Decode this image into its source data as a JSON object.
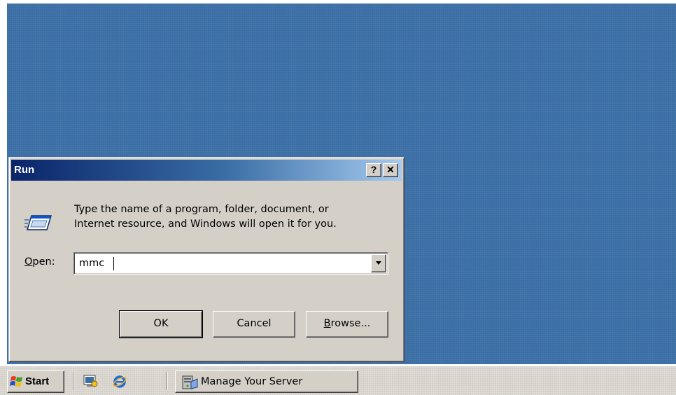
{
  "dialog": {
    "title": "Run",
    "help_label": "?",
    "close_label": "✕",
    "description_line1": "Type the name of a program, folder, document, or",
    "description_line2": "Internet resource, and Windows will open it for you.",
    "open_label_accel": "O",
    "open_label_rest": "pen:",
    "open_value": "mmc",
    "ok_label": "OK",
    "cancel_label": "Cancel",
    "browse_label": "Browse..."
  },
  "taskbar": {
    "start_label": "Start",
    "task_label": "Manage Your Server"
  },
  "colors": {
    "desktop": "#3a6ea5",
    "title_bar_start": "#0a246a",
    "face": "#d4d0c8"
  },
  "icons": {
    "run": "run-icon",
    "windows_logo": "windows-logo-icon",
    "quicklaunch_desktop": "show-desktop-icon",
    "quicklaunch_ie": "internet-explorer-icon",
    "server": "server-icon"
  }
}
